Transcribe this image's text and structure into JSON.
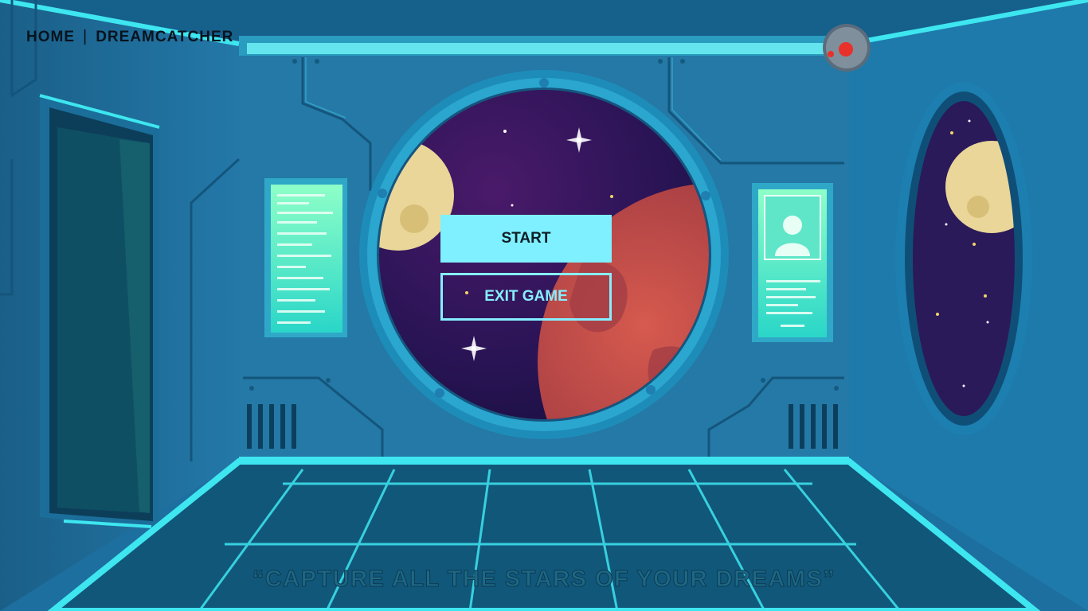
{
  "nav": {
    "home": "HOME",
    "separator": "|",
    "title": "DREAMCATCHER"
  },
  "menu": {
    "start": "START",
    "exit": "EXIT GAME"
  },
  "tagline": "“CAPTURE ALL THE STARS OF YOUR DREAMS”",
  "colors": {
    "accent": "#7ff0ff",
    "wall": "#1a6f9e",
    "floor": "#0f5577",
    "glow": "#3ee6f0",
    "space": "#2a1456",
    "planet": "#c95048",
    "moon": "#e9d698"
  },
  "icons": {
    "robot": "security-camera-orb",
    "door": "sliding-door",
    "screen": "terminal-panel"
  }
}
